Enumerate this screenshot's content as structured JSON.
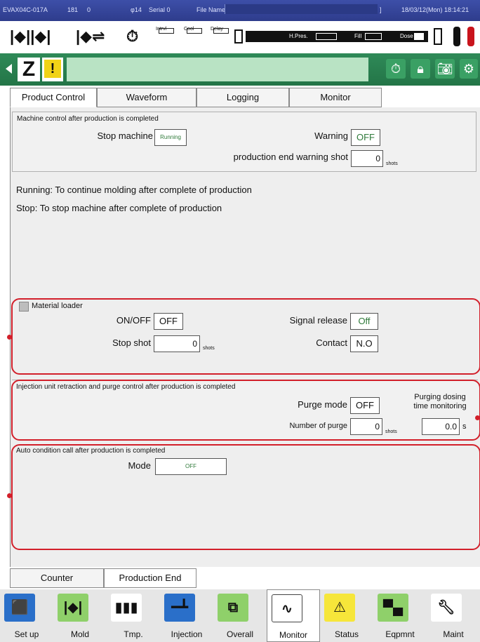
{
  "titlebar": {
    "machine": "EVAX04C-017A",
    "num1": "181",
    "num2": "0",
    "mold": "φ14",
    "serial": "Serial 0",
    "file_name_label": "File Name[",
    "file_name_end": "]",
    "datetime": "18/03/12(Mon) 18:14:21"
  },
  "toolbar": {
    "intrvl": "Intrvl",
    "cool": "Cool",
    "delay": "Delay",
    "hpres": "H.Pres.",
    "fill": "Fill",
    "dose": "Dose"
  },
  "greenbar": {
    "z_label": "Z",
    "warn_symbol": "!"
  },
  "tabs": [
    "Product Control",
    "Waveform",
    "Logging",
    "Monitor"
  ],
  "machine_control": {
    "title": "Machine control after production is completed",
    "stop_machine_label": "Stop machine",
    "stop_machine_value": "Running",
    "warning_label": "Warning",
    "warning_value": "OFF",
    "end_warning_label": "production end warning shot",
    "end_warning_value": "0",
    "end_warning_unit": "shots"
  },
  "notes": {
    "running": "Running: To continue molding after complete of production",
    "stop": "Stop: To stop machine after complete of  production"
  },
  "material_loader": {
    "title": "Material loader",
    "onoff_label": "ON/OFF",
    "onoff_value": "OFF",
    "signal_release_label": "Signal release",
    "signal_release_value": "Off",
    "stop_shot_label": "Stop shot",
    "stop_shot_value": "0",
    "stop_shot_unit": "shots",
    "contact_label": "Contact",
    "contact_value": "N.O"
  },
  "injection_unit": {
    "title": "Injection unit retraction and purge control after production is completed",
    "purge_mode_label": "Purge mode",
    "purge_mode_value": "OFF",
    "purging_dosing_label_1": "Purging dosing",
    "purging_dosing_label_2": "time monitoring",
    "number_of_purge_label": "Number of purge",
    "number_of_purge_value": "0",
    "number_of_purge_unit": "shots",
    "purging_time_value": "0.0",
    "purging_time_unit": "s"
  },
  "auto_condition": {
    "title": "Auto condition call after production is completed",
    "mode_label": "Mode",
    "mode_value": "OFF"
  },
  "bottom_tabs": [
    "Counter",
    "Production End"
  ],
  "nav": [
    {
      "label": "Set up",
      "icon": "setup-icon"
    },
    {
      "label": "Mold",
      "icon": "mold-icon"
    },
    {
      "label": "Tmp.",
      "icon": "temperature-icon"
    },
    {
      "label": "Injection",
      "icon": "injection-icon"
    },
    {
      "label": "Overall",
      "icon": "overall-icon"
    },
    {
      "label": "Monitor",
      "icon": "monitor-wave-icon"
    },
    {
      "label": "Status",
      "icon": "warning-icon"
    },
    {
      "label": "Eqpmnt",
      "icon": "equipment-icon"
    },
    {
      "label": "Maint",
      "icon": "wrench-icon"
    }
  ],
  "colors": {
    "title_bar": "#2e3c8c",
    "green_bar": "#237547",
    "highlight_frame": "#d21f2a",
    "value_text": "#2f7a3a",
    "warning_yellow": "#f1d317"
  }
}
